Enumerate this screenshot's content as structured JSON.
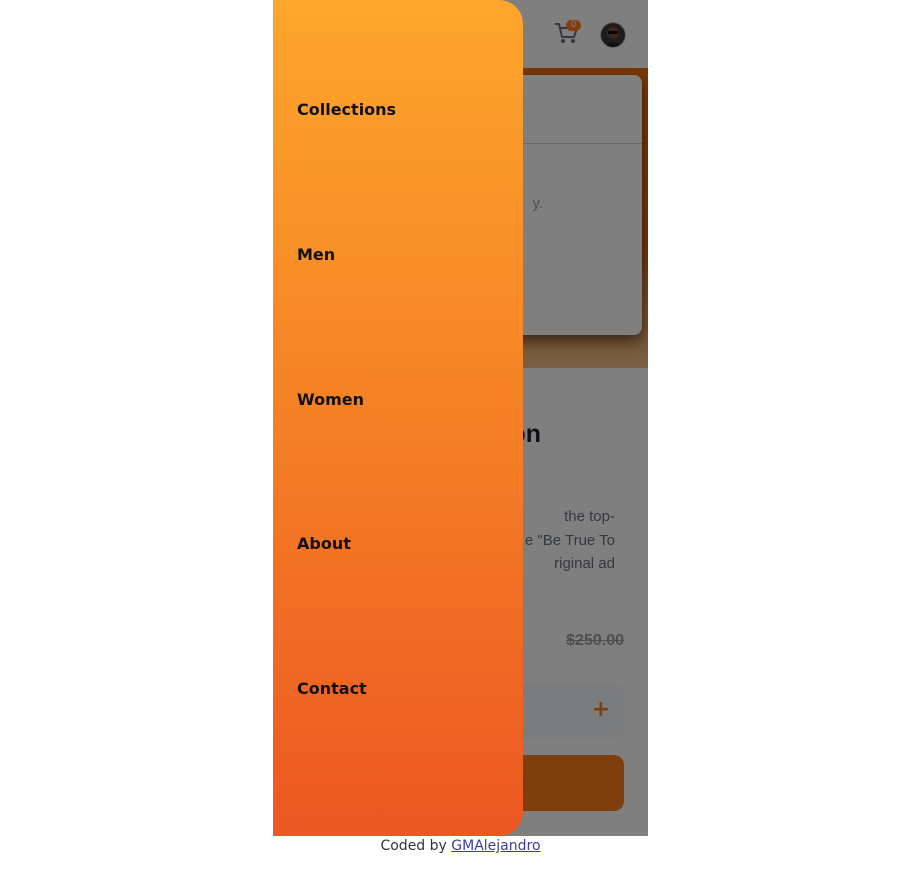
{
  "header": {
    "cart_count": "0",
    "cart_icon": "cart-icon",
    "avatar": "avatar"
  },
  "modal": {
    "text_fragment": "y."
  },
  "product": {
    "title_fragment": "on",
    "description_lines": [
      "the top-",
      "e \"Be True To",
      "riginal ad"
    ],
    "old_price": "$250.00"
  },
  "quantity": {
    "plus_label": "+"
  },
  "nav": {
    "items": [
      "Collections",
      "Men",
      "Women",
      "About",
      "Contact"
    ]
  },
  "footer": {
    "prefix": "Coded by ",
    "link_text": "GMAlejandro"
  },
  "colors": {
    "accent": "#ff7d1a",
    "drawer_top": "#fda62d",
    "drawer_bottom": "#ec5722"
  }
}
